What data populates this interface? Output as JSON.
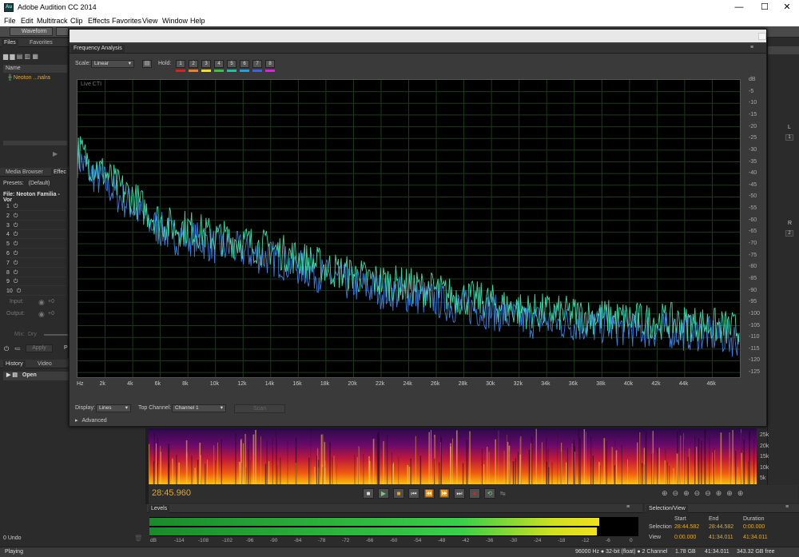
{
  "app": {
    "title": "Adobe Audition CC 2014",
    "logo": "Au",
    "window_controls": {
      "minimize": "—",
      "maximize": "☐",
      "close": "✕"
    }
  },
  "menu": [
    "File",
    "Edit",
    "Multitrack",
    "Clip",
    "Effects",
    "Favorites",
    "View",
    "Window",
    "Help"
  ],
  "toolbar": {
    "waveform": "Waveform"
  },
  "files_panel": {
    "tabs": [
      "Files",
      "Favorites"
    ],
    "column": "Name",
    "item": "Neoton ...nalra"
  },
  "effects_panel": {
    "tabs": [
      "Media Browser",
      "Effec"
    ],
    "presets_label": "Presets:",
    "presets_value": "(Default)",
    "file_label": "File: Neoton Familia - Vor",
    "rack_slots": [
      "1",
      "2",
      "3",
      "4",
      "5",
      "6",
      "7",
      "8",
      "9",
      "10"
    ],
    "input_label": "Input:",
    "input_value": "+0",
    "output_label": "Output:",
    "output_value": "+0",
    "mix_label": "Mix:",
    "dry_label": "Dry",
    "apply_label": "Apply",
    "p_label": "P"
  },
  "history_panel": {
    "tabs": [
      "History",
      "Video"
    ],
    "item": "Open",
    "undo_count": "0 Undo"
  },
  "frequency_analysis": {
    "tab": "Frequency Analysis",
    "scale_label": "Scale:",
    "scale_value": "Linear",
    "hold_label": "Hold:",
    "hold_buttons": [
      "1",
      "2",
      "3",
      "4",
      "5",
      "6",
      "7",
      "8"
    ],
    "hold_colors": [
      "#e02020",
      "#f08020",
      "#f0e020",
      "#40c040",
      "#20c0a0",
      "#20a0e0",
      "#4060e0",
      "#e020e0"
    ],
    "plot_label": "Live CTI",
    "display_label": "Display:",
    "display_value": "Lines",
    "top_channel_label": "Top Channel:",
    "top_channel_value": "Channel 1",
    "scan_label": "Scan",
    "advanced_label": "Advanced"
  },
  "chart_data": {
    "type": "line",
    "xlabel": "Hz",
    "ylabel": "dB",
    "x_ticks": [
      "Hz",
      "2k",
      "4k",
      "6k",
      "8k",
      "10k",
      "12k",
      "14k",
      "16k",
      "18k",
      "20k",
      "22k",
      "24k",
      "26k",
      "28k",
      "30k",
      "32k",
      "34k",
      "36k",
      "38k",
      "40k",
      "42k",
      "44k",
      "46k"
    ],
    "y_ticks": [
      "dB",
      "-5",
      "-10",
      "-15",
      "-20",
      "-25",
      "-30",
      "-35",
      "-40",
      "-45",
      "-50",
      "-55",
      "-60",
      "-65",
      "-70",
      "-75",
      "-80",
      "-85",
      "-90",
      "-95",
      "-100",
      "-105",
      "-110",
      "-115",
      "-120",
      "-125"
    ],
    "xlim": [
      0,
      48000
    ],
    "ylim": [
      -127,
      0
    ],
    "grid": true,
    "series": [
      {
        "x": [
          100,
          1000,
          2000,
          3000,
          4000,
          5000,
          6000,
          7000,
          8000,
          9000,
          10000,
          11000,
          12000,
          13000,
          14000,
          15000,
          16000,
          17000,
          18000,
          19000,
          20000,
          21000,
          22000,
          23000,
          24000,
          25000,
          26000,
          27000,
          28000,
          29000,
          30000,
          31000,
          32000,
          33000,
          34000,
          35000,
          36000,
          37000,
          38000,
          39000,
          40000,
          41000,
          42000,
          43000,
          44000,
          45000,
          46000,
          47000,
          48000
        ],
        "values": [
          -30,
          -36,
          -40,
          -46,
          -50,
          -56,
          -60,
          -63,
          -63,
          -65,
          -67,
          -68,
          -69,
          -71,
          -72,
          -74,
          -76,
          -78,
          -80,
          -82,
          -83,
          -85,
          -86,
          -87,
          -88,
          -89,
          -90,
          -92,
          -93,
          -94,
          -95,
          -97,
          -98,
          -99,
          -99,
          -100,
          -100,
          -101,
          -101,
          -102,
          -102,
          -103,
          -103,
          -103,
          -104,
          -104,
          -105,
          -106,
          -107
        ]
      }
    ],
    "colors": [
      "#3fd9a8",
      "#3a7ee0"
    ]
  },
  "spectrogram_scale": [
    "25k",
    "20k",
    "15k",
    "10k",
    "5k"
  ],
  "transport": {
    "timecode": "28:45.960"
  },
  "levels_panel": {
    "tab": "Levels",
    "scale": [
      "dB",
      "-114",
      "-108",
      "-102",
      "-96",
      "-90",
      "-84",
      "-78",
      "-72",
      "-66",
      "-60",
      "-54",
      "-48",
      "-42",
      "-36",
      "-30",
      "-24",
      "-18",
      "-12",
      "-6",
      "0"
    ],
    "meter_level_fraction": 0.92
  },
  "selection_view": {
    "tab": "Selection/View",
    "headers": [
      "Start",
      "End",
      "Duration"
    ],
    "selection_label": "Selection",
    "selection": [
      "28:44.582",
      "28:44.582",
      "0:00.000"
    ],
    "view_label": "View",
    "view": [
      "0:00.000",
      "41:34.011",
      "41:34.011"
    ]
  },
  "status": {
    "state": "Playing",
    "format": "96000 Hz ● 32-bit (float) ● 2 Channel",
    "size": "1.78 GB",
    "duration": "41:34.011",
    "free": "343.32 GB free"
  },
  "right_channel_labels": [
    "L",
    "1",
    "R",
    "2",
    "L",
    "R"
  ]
}
